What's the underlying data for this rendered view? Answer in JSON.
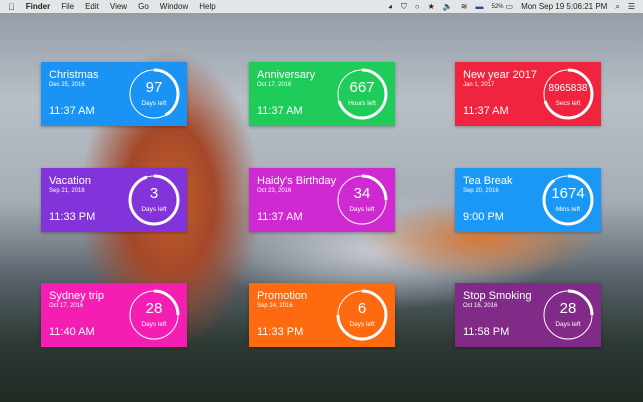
{
  "menubar": {
    "apple": "",
    "app": "Finder",
    "items": [
      "File",
      "Edit",
      "View",
      "Go",
      "Window",
      "Help"
    ],
    "status_icons": [
      "◕",
      "⛉",
      "○",
      "★",
      "🔈",
      "≋",
      "▬"
    ],
    "battery": "52%",
    "battery_icon": "▭",
    "clock": "Mon Sep 19  5:06:21 PM",
    "search": "⌕",
    "list": "☰"
  },
  "cards": [
    {
      "title": "Christmas",
      "date": "Dec 25, 2016",
      "time": "11:37 AM",
      "value": "97",
      "unit": "Days left",
      "color": "#1a93f5",
      "progress": 0.42
    },
    {
      "title": "Anniversary",
      "date": "Oct 17, 2016",
      "time": "11:37 AM",
      "value": "667",
      "unit": "Hours left",
      "color": "#1fcc5a",
      "progress": 0.7
    },
    {
      "title": "New year 2017",
      "date": "Jan 1, 2017",
      "time": "11:37 AM",
      "value": "8965838",
      "unit": "Secs left",
      "color": "#f0243e",
      "progress": 0.7
    },
    {
      "title": "Vacation",
      "date": "Sep 21, 2016",
      "time": "11:33 PM",
      "value": "3",
      "unit": "Days left",
      "color": "#8234da",
      "progress": 0.95
    },
    {
      "title": "Haidy's Birthday",
      "date": "Oct 23, 2016",
      "time": "11:37 AM",
      "value": "34",
      "unit": "Days left",
      "color": "#cf2ad2",
      "progress": 0.25
    },
    {
      "title": "Tea Break",
      "date": "Sep 20, 2016",
      "time": "9:00 PM",
      "value": "1674",
      "unit": "Mins left",
      "color": "#1a98f5",
      "progress": 0.9
    },
    {
      "title": "Sydney trip",
      "date": "Oct 17, 2016",
      "time": "11:40 AM",
      "value": "28",
      "unit": "Days left",
      "color": "#f41fb2",
      "progress": 0.25
    },
    {
      "title": "Promotion",
      "date": "Sep 24, 2016",
      "time": "11:33 PM",
      "value": "6",
      "unit": "Days left",
      "color": "#fd6a10",
      "progress": 0.75
    },
    {
      "title": "Stop Smoking",
      "date": "Oct 16, 2016",
      "time": "11:58 PM",
      "value": "28",
      "unit": "Days left",
      "color": "#822a88",
      "progress": 0.25
    }
  ]
}
